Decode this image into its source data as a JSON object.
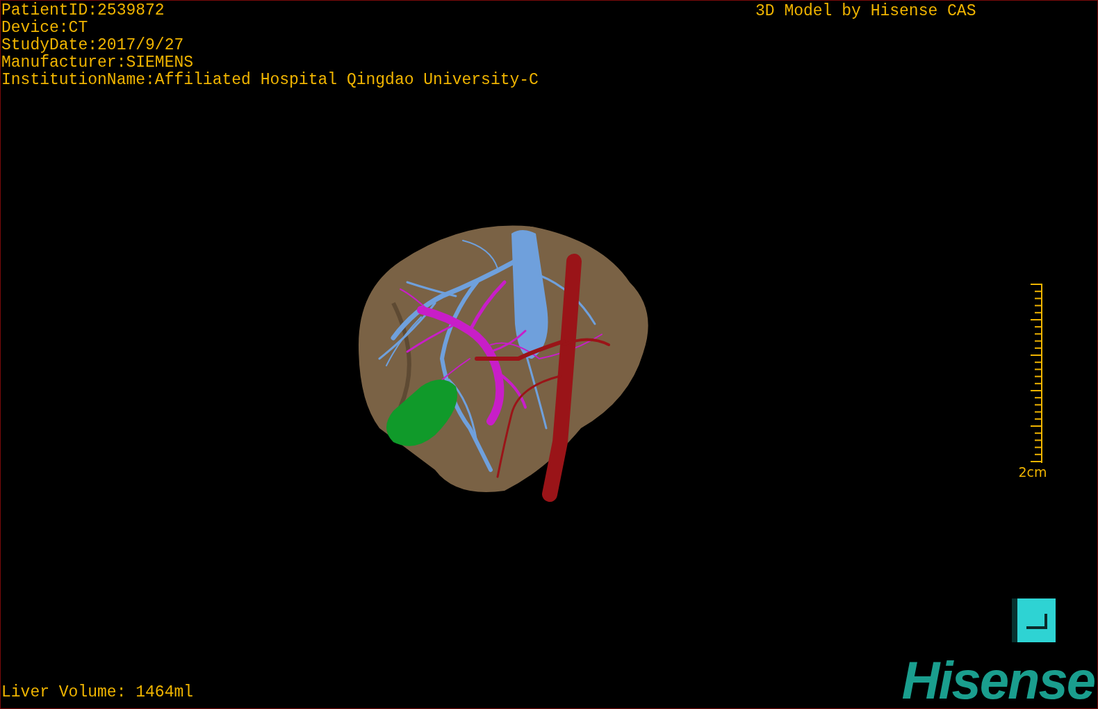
{
  "info_lines": [
    "PatientID:2539872",
    "Device:CT",
    "StudyDate:2017/9/27",
    "Manufacturer:SIEMENS",
    "InstitutionName:Affiliated Hospital Qingdao University-C"
  ],
  "header_label": "3D Model by Hisense CAS",
  "scale": {
    "label": "2cm"
  },
  "volume": "Liver Volume: 1464ml",
  "logo": "Hisense"
}
